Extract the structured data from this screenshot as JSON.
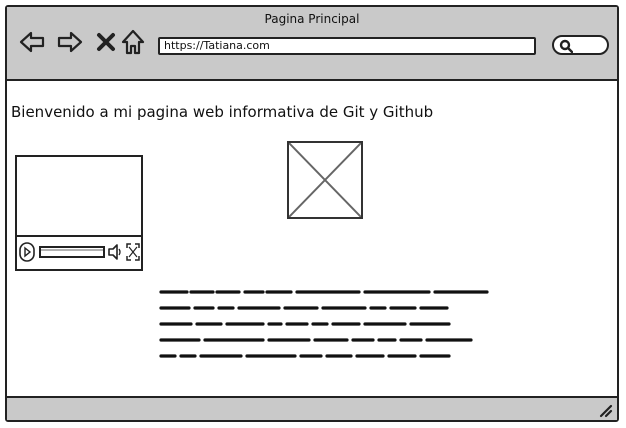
{
  "window": {
    "title": "Pagina Principal"
  },
  "toolbar": {
    "back_icon": "arrow-left-icon",
    "forward_icon": "arrow-right-icon",
    "stop_icon": "close-icon",
    "home_icon": "home-icon",
    "url": "https://Tatiana.com",
    "search_icon": "search-icon"
  },
  "main": {
    "heading": "Bienvenido a mi pagina web informativa de Git y Github",
    "video_player": {
      "progress": 0
    },
    "image_placeholder": "image-placeholder"
  }
}
